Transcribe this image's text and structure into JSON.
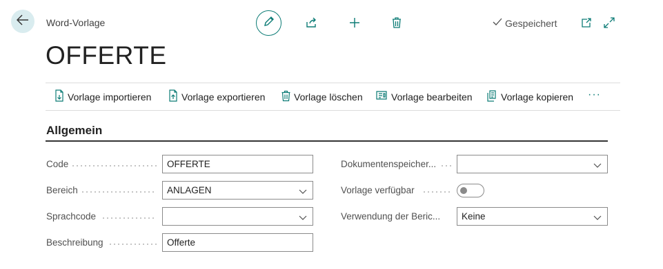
{
  "header": {
    "caption": "Word-Vorlage",
    "title": "OFFERTE",
    "saved_status": "Gespeichert"
  },
  "actions": [
    {
      "label": "Vorlage importieren",
      "icon": "import-file-icon"
    },
    {
      "label": "Vorlage exportieren",
      "icon": "export-file-icon"
    },
    {
      "label": "Vorlage löschen",
      "icon": "trash-icon"
    },
    {
      "label": "Vorlage bearbeiten",
      "icon": "edit-document-icon"
    },
    {
      "label": "Vorlage kopieren",
      "icon": "copy-icon"
    }
  ],
  "more_label": "···",
  "section": {
    "title": "Allgemein",
    "left_fields": [
      {
        "label": "Code",
        "value": "OFFERTE",
        "type": "text"
      },
      {
        "label": "Bereich",
        "value": "ANLAGEN",
        "type": "dropdown"
      },
      {
        "label": "Sprachcode",
        "value": "",
        "type": "dropdown"
      },
      {
        "label": "Beschreibung",
        "value": "Offerte",
        "type": "text"
      }
    ],
    "right_fields": [
      {
        "label": "Dokumentenspeicher...",
        "value": "",
        "type": "dropdown"
      },
      {
        "label": "Vorlage verfügbar",
        "value": "off",
        "type": "toggle"
      },
      {
        "label": "Verwendung der Beric...",
        "value": "Keine",
        "type": "dropdown"
      }
    ]
  },
  "colors": {
    "accent": "#0b7b75",
    "back_button_bg": "#d9ecef"
  }
}
